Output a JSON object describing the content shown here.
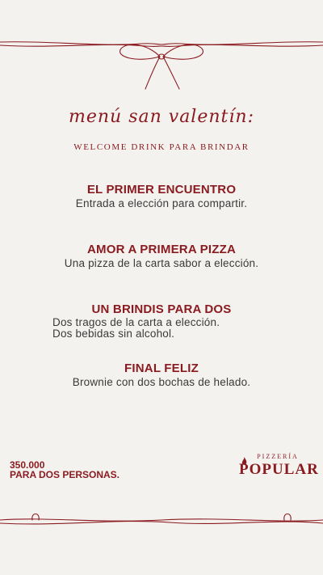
{
  "header": {
    "script_title": "menú san valentín:",
    "welcome": "WELCOME DRINK PARA BRINDAR"
  },
  "courses": [
    {
      "title": "EL PRIMER ENCUENTRO",
      "desc": [
        "Entrada a elección para compartir."
      ]
    },
    {
      "title": "AMOR A PRIMERA PIZZA",
      "desc": [
        "Una pizza de la carta sabor a elección."
      ]
    },
    {
      "title": "UN BRINDIS PARA DOS",
      "desc": [
        "Dos tragos de la carta a elección.",
        "Dos bebidas sin alcohol."
      ]
    },
    {
      "title": "FINAL FELIZ",
      "desc": [
        "Brownie con dos bochas de helado."
      ]
    }
  ],
  "price": {
    "amount": "350.000",
    "label": "PARA DOS PERSONAS."
  },
  "brand": {
    "sub": "PIZZERÍA",
    "name": "POPULAR"
  },
  "colors": {
    "accent": "#8a1a1f",
    "background": "#f4f2ef",
    "text": "#3a3a3a"
  },
  "icons": {
    "top": "ribbon-bow-icon",
    "bottom": "ribbon-line-icon",
    "brand": "flame-icon"
  }
}
